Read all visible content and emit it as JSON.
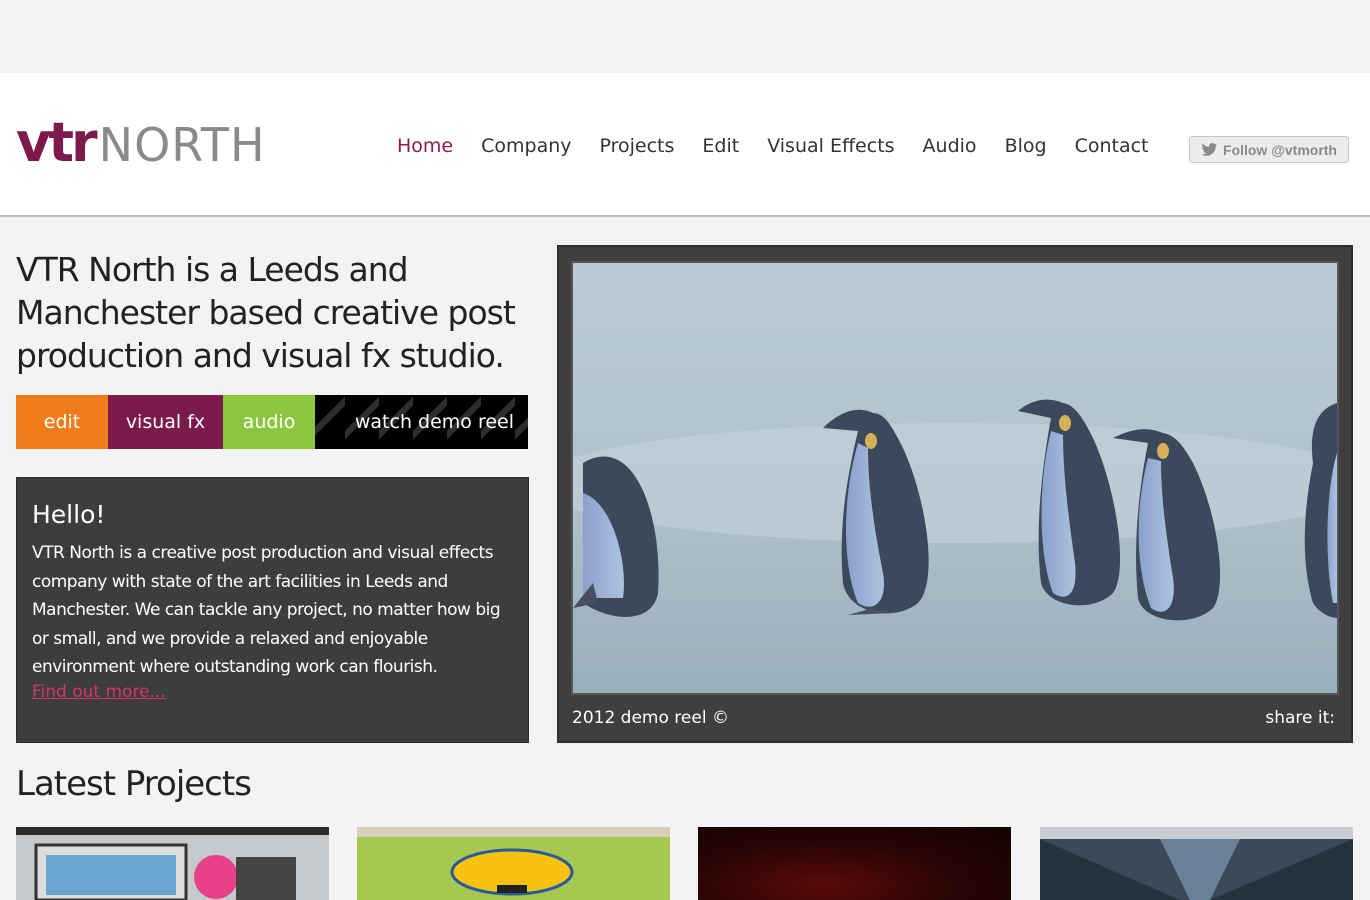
{
  "header": {
    "logo": {
      "part1": "vtr",
      "part2": "NORTH"
    },
    "nav": [
      "Home",
      "Company",
      "Projects",
      "Edit",
      "Visual Effects",
      "Audio",
      "Blog",
      "Contact"
    ],
    "active_nav": "Home",
    "follow_label": "Follow @vtmorth"
  },
  "intro": {
    "text": "VTR North is a Leeds and Manchester based creative post production and visual fx studio."
  },
  "categories": [
    {
      "label": "edit",
      "color": "#f07c1a"
    },
    {
      "label": "visual fx",
      "color": "#7b1a4b"
    },
    {
      "label": "audio",
      "color": "#8cc63f"
    },
    {
      "label": "watch demo reel",
      "color": "#000000"
    }
  ],
  "hello": {
    "title": "Hello!",
    "body": "VTR North is a creative post production and visual effects company with state of the art facilities in Leeds and Manchester. We can tackle any project, no matter how big or small, and we provide a relaxed and enjoyable environment where outstanding work can flourish.",
    "link": "Find out more..."
  },
  "player": {
    "caption": "2012 demo reel ©",
    "share": "share it:"
  },
  "latest": {
    "title": "Latest Projects"
  }
}
